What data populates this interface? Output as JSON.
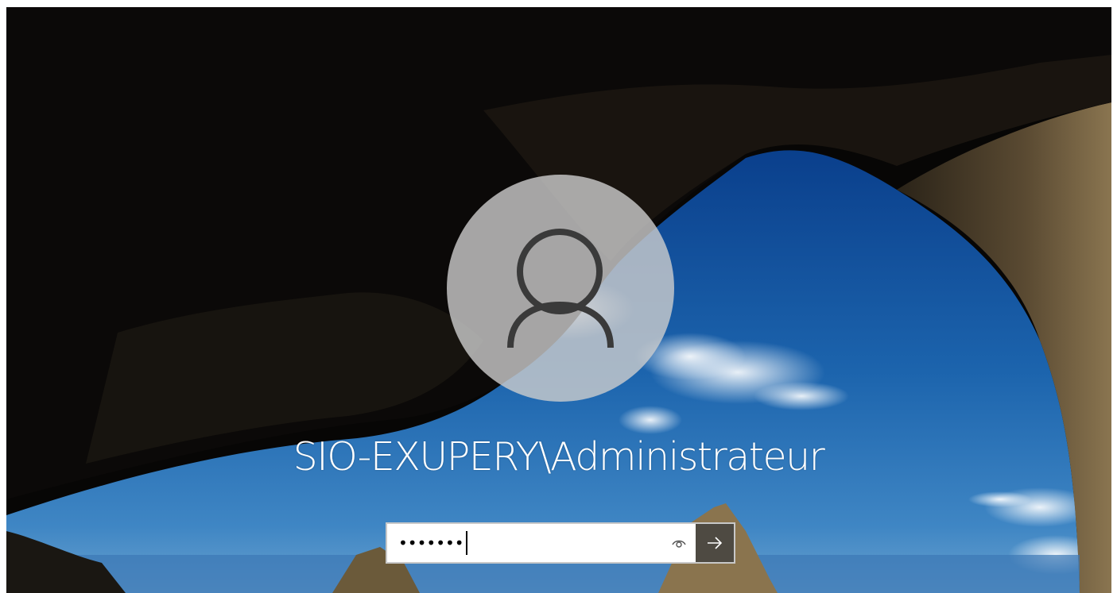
{
  "login": {
    "user_display": "SIO-EXUPERY\\Administrateur",
    "password_masked": "•••••••",
    "icons": {
      "avatar": "user-silhouette-icon",
      "reveal": "eye-icon",
      "submit": "arrow-right-icon"
    }
  },
  "colors": {
    "avatar_bg": "#cdcdcd",
    "avatar_stroke": "#3a3a3a",
    "submit_bg": "#4e4a42",
    "text": "#ffffff"
  }
}
